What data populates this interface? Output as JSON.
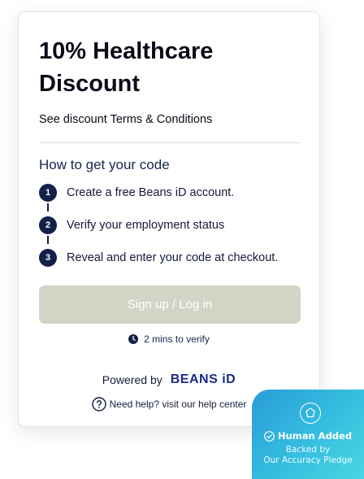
{
  "offer": {
    "title": "10% Healthcare Discount",
    "terms_link": "See discount Terms & Conditions"
  },
  "how_to": {
    "heading": "How to get your code",
    "steps": [
      {
        "number": "1",
        "text": "Create a free Beans iD account."
      },
      {
        "number": "2",
        "text": "Verify your employment status"
      },
      {
        "number": "3",
        "text": "Reveal and enter your code at checkout."
      }
    ]
  },
  "cta": {
    "label": "Sign up / Log in"
  },
  "verify_time": {
    "icon": "clock-icon",
    "text": "2 mins to verify"
  },
  "powered_by": {
    "label": "Powered by",
    "brand": "BEANS iD"
  },
  "help": {
    "icon": "question-circle-icon",
    "text": "Need help? visit our help center"
  },
  "badge": {
    "icon": "shield-icon",
    "title": "Human Added",
    "line1": "Backed by",
    "line2": "Our Accuracy Pledge"
  },
  "colors": {
    "step_circle": "#12214a",
    "cta_disabled": "#d3d4c6",
    "brand_blue": "#1b2a8a",
    "badge_gradient_start": "#2a9bd6",
    "badge_gradient_end": "#49d6e1"
  }
}
